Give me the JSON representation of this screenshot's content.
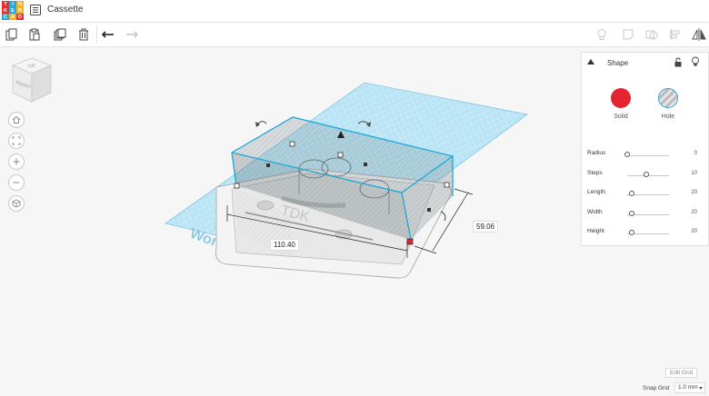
{
  "app": {
    "logo_letters": [
      "T",
      "I",
      "N",
      "K",
      "E",
      "R",
      "C",
      "A",
      "D"
    ],
    "logo_colors": [
      "#e5302b",
      "#2fa6d9",
      "#f3b11e",
      "#e5302b",
      "#2fa6d9",
      "#f3b11e",
      "#2fa6d9",
      "#f3b11e",
      "#e5302b"
    ],
    "title": "Cassette"
  },
  "toolbar": {
    "icons": [
      "copy-icon",
      "paste-icon",
      "duplicate-icon",
      "delete-icon",
      "undo-icon",
      "redo-icon",
      "bulb-icon",
      "note-icon",
      "group-icon",
      "align-icon",
      "mirror-icon"
    ]
  },
  "viewcube": {
    "top_label": "TOP",
    "front_label": "FRONT"
  },
  "nav": {
    "icons": [
      "home-icon",
      "fit-icon",
      "zoom-in-icon",
      "zoom-out-icon",
      "orbit-icon"
    ]
  },
  "workplane": {
    "label": "Workplane",
    "grid_color": "#9fd9f0",
    "selection_color": "#1aa9d6"
  },
  "dimensions": {
    "width": "110.40",
    "depth": "59.06"
  },
  "inspector": {
    "title": "Shape",
    "solid_label": "Solid",
    "hole_label": "Hole",
    "solid_color": "#e52431",
    "params": [
      {
        "label": "Radius",
        "value": "0",
        "fraction": 0.0
      },
      {
        "label": "Steps",
        "value": "10",
        "fraction": 0.45
      },
      {
        "label": "Length",
        "value": "20",
        "fraction": 0.1
      },
      {
        "label": "Width",
        "value": "20",
        "fraction": 0.1
      },
      {
        "label": "Height",
        "value": "20",
        "fraction": 0.1
      }
    ]
  },
  "grid": {
    "edit_label": "Edit Grid",
    "snap_label": "Snap Grid",
    "snap_value": "1.0 mm"
  }
}
